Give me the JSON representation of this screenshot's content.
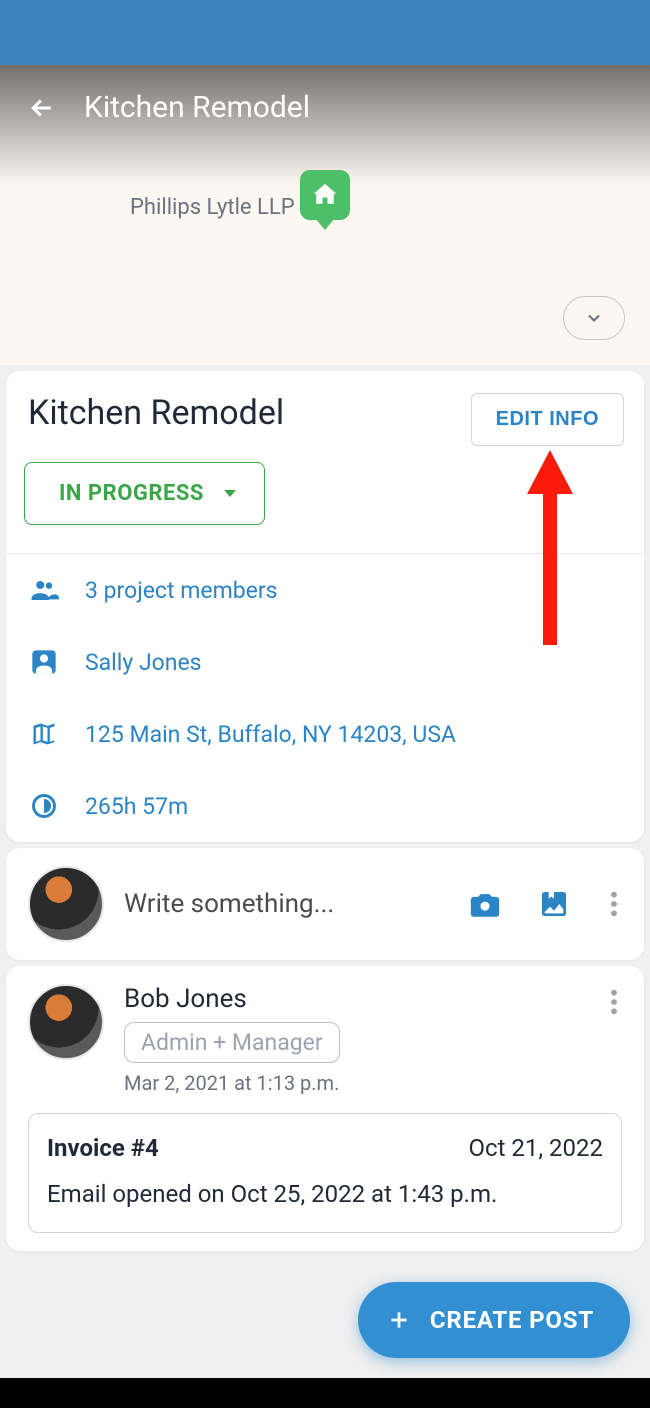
{
  "header": {
    "title": "Kitchen Remodel"
  },
  "map": {
    "nearby_label": "Phillips Lytle LLP"
  },
  "project": {
    "title": "Kitchen Remodel",
    "edit_label": "EDIT INFO",
    "status": "IN PROGRESS",
    "members_label": "3 project members",
    "client_name": "Sally Jones",
    "address": "125 Main St, Buffalo, NY 14203, USA",
    "time_logged": "265h 57m"
  },
  "compose": {
    "placeholder": "Write something..."
  },
  "post": {
    "author": "Bob Jones",
    "role": "Admin + Manager",
    "timestamp": "Mar 2, 2021 at 1:13 p.m.",
    "invoice": {
      "title": "Invoice #4",
      "date": "Oct 21, 2022",
      "body": "Email opened on Oct 25, 2022 at 1:43 p.m."
    }
  },
  "fab": {
    "label": "CREATE POST"
  }
}
